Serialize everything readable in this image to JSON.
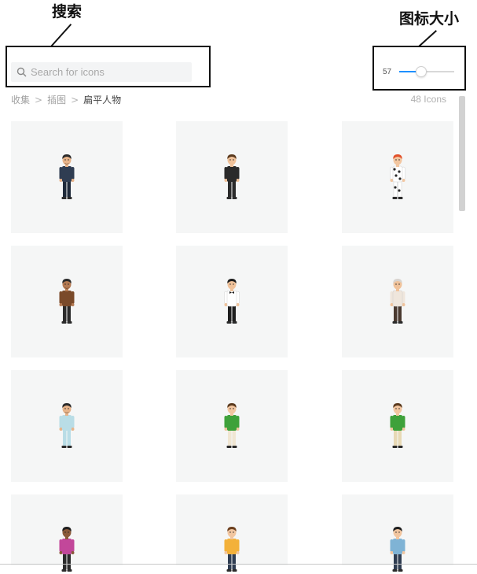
{
  "annotations": {
    "search_label": "搜索",
    "size_label": "图标大小"
  },
  "search": {
    "placeholder": "Search for icons",
    "icon": "search-icon"
  },
  "icon_size": {
    "value": "57",
    "slider_fraction": 0.36,
    "accent_color": "#1e90ff"
  },
  "breadcrumb": {
    "items": [
      "收集",
      "插图",
      "扁平人物"
    ],
    "separator": ">"
  },
  "icon_count": "48 Icons",
  "icons": [
    {
      "name": "bearded-man-dark-suit",
      "skin": "#e8b48a",
      "hair": "#2b2b2b",
      "top": "#2f3d52",
      "bottom": "#1f2a3a",
      "beard": true
    },
    {
      "name": "man-black-suit",
      "skin": "#f0c29a",
      "hair": "#5a3a1e",
      "top": "#2a2a2a",
      "bottom": "#2a2a2a"
    },
    {
      "name": "redhead-cow-print",
      "skin": "#f2c6a0",
      "hair": "#e2502a",
      "top": "#ffffff",
      "bottom": "#ffffff",
      "pattern": true
    },
    {
      "name": "bearded-man-brown-shirt",
      "skin": "#b57a52",
      "hair": "#2b2b2b",
      "top": "#7a4a2a",
      "bottom": "#2b2b2b",
      "beard": true
    },
    {
      "name": "waiter-white-shirt",
      "skin": "#f0c29a",
      "hair": "#1e1e1e",
      "top": "#ffffff",
      "bottom": "#1e1e1e",
      "bow": true
    },
    {
      "name": "curly-grey-hair-man",
      "skin": "#f0c29a",
      "hair": "#d9d4cf",
      "top": "#efe6dc",
      "bottom": "#4a3a30"
    },
    {
      "name": "bearded-man-light-blue",
      "skin": "#e8b48a",
      "hair": "#2b2b2b",
      "top": "#b9dde6",
      "bottom": "#b9dde6",
      "beard": true
    },
    {
      "name": "boy-green-shirt",
      "skin": "#f2c6a0",
      "hair": "#5a3a1e",
      "top": "#3ea13a",
      "bottom": "#f0e6d2"
    },
    {
      "name": "man-green-shirt",
      "skin": "#f2c6a0",
      "hair": "#5a3a1e",
      "top": "#3ea13a",
      "bottom": "#e8d9b5"
    },
    {
      "name": "curly-hair-pink-shirt",
      "skin": "#8a5a3a",
      "hair": "#1e1e1e",
      "top": "#c2479a",
      "bottom": "#2b2b2b"
    },
    {
      "name": "girl-yellow-shirt",
      "skin": "#f2c6a0",
      "hair": "#6b3f1e",
      "top": "#f3b13a",
      "bottom": "#2f3d52"
    },
    {
      "name": "boy-blue-shirt",
      "skin": "#f2c6a0",
      "hair": "#1e1e1e",
      "top": "#7fb3d5",
      "bottom": "#2f3d52"
    }
  ]
}
